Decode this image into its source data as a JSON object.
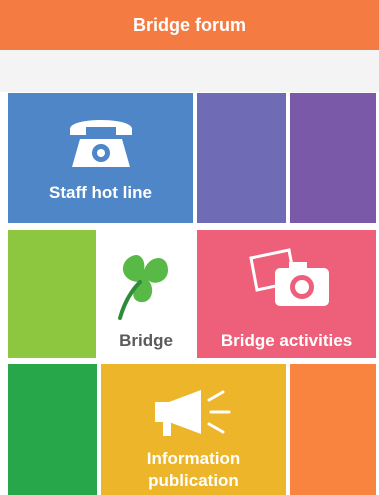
{
  "header": {
    "title": "Bridge forum"
  },
  "tiles": {
    "staff_hotline": {
      "label": "Staff hot line",
      "color": "#4e86c7"
    },
    "bridge": {
      "label": "Bridge",
      "color": "#ffffff"
    },
    "bridge_activities": {
      "label": "Bridge activities",
      "color": "#ee5f7a"
    },
    "information_publication": {
      "label_line1": "Information",
      "label_line2": "publication",
      "color": "#edb52a"
    }
  },
  "colors": {
    "header": "#f47c42",
    "purple_blue": "#6f6cb5",
    "purple": "#7a5aa8",
    "green_light": "#8dc63f",
    "green_dark": "#27a74a",
    "orange": "#f8843f"
  },
  "icons": {
    "phone": "telephone-icon",
    "logo": "bridge-leaf-logo-icon",
    "camera": "camera-photo-icon",
    "megaphone": "megaphone-icon"
  }
}
